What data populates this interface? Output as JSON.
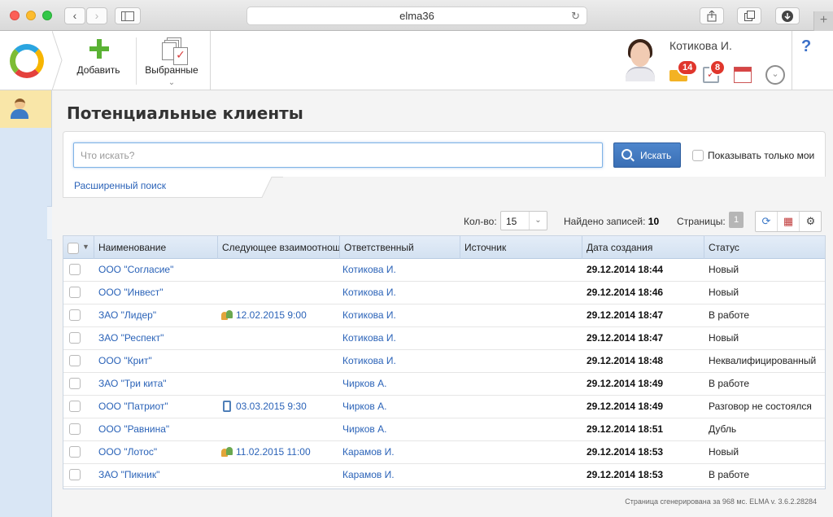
{
  "browser": {
    "url": "elma36",
    "back": "‹",
    "forward": "›",
    "new_tab": "+"
  },
  "toolbar": {
    "add_label": "Добавить",
    "favorites_label": "Выбранные"
  },
  "user": {
    "name": "Котикова И.",
    "mail_count": "14",
    "task_count": "8"
  },
  "help_label": "?",
  "page": {
    "title": "Потенциальные клиенты"
  },
  "search": {
    "placeholder": "Что искать?",
    "value": "",
    "button_label": "Искать",
    "only_mine_label": "Показывать только мои",
    "advanced_link": "Расширенный поиск"
  },
  "list_controls": {
    "qty_label": "Кол-во:",
    "qty_value": "15",
    "found_label": "Найдено записей:",
    "found_value": "10",
    "pages_label": "Страницы:",
    "current_page": "1"
  },
  "table": {
    "columns": [
      "Наименование",
      "Следующее взаимоотношение",
      "Ответственный",
      "Источник",
      "Дата создания",
      "Статус"
    ],
    "rows": [
      {
        "name": "ООО \"Согласие\"",
        "next": "",
        "next_icon": "",
        "owner": "Котикова И.",
        "source": "",
        "created": "29.12.2014 18:44",
        "status": "Новый"
      },
      {
        "name": "ООО \"Инвест\"",
        "next": "",
        "next_icon": "",
        "owner": "Котикова И.",
        "source": "",
        "created": "29.12.2014 18:46",
        "status": "Новый"
      },
      {
        "name": "ЗАО \"Лидер\"",
        "next": "12.02.2015 9:00",
        "next_icon": "meeting",
        "owner": "Котикова И.",
        "source": "",
        "created": "29.12.2014 18:47",
        "status": "В работе"
      },
      {
        "name": "ЗАО \"Респект\"",
        "next": "",
        "next_icon": "",
        "owner": "Котикова И.",
        "source": "",
        "created": "29.12.2014 18:47",
        "status": "Новый"
      },
      {
        "name": "ООО \"Крит\"",
        "next": "",
        "next_icon": "",
        "owner": "Котикова И.",
        "source": "",
        "created": "29.12.2014 18:48",
        "status": "Неквалифицированный"
      },
      {
        "name": "ЗАО \"Три кита\"",
        "next": "",
        "next_icon": "",
        "owner": "Чирков А.",
        "source": "",
        "created": "29.12.2014 18:49",
        "status": "В работе"
      },
      {
        "name": "ООО \"Патриот\"",
        "next": "03.03.2015 9:30",
        "next_icon": "phone",
        "owner": "Чирков А.",
        "source": "",
        "created": "29.12.2014 18:49",
        "status": "Разговор не состоялся"
      },
      {
        "name": "ООО \"Равнина\"",
        "next": "",
        "next_icon": "",
        "owner": "Чирков А.",
        "source": "",
        "created": "29.12.2014 18:51",
        "status": "Дубль"
      },
      {
        "name": "ООО \"Лотос\"",
        "next": "11.02.2015 11:00",
        "next_icon": "meeting",
        "owner": "Карамов И.",
        "source": "",
        "created": "29.12.2014 18:53",
        "status": "Новый"
      },
      {
        "name": "ЗАО \"Пикник\"",
        "next": "",
        "next_icon": "",
        "owner": "Карамов И.",
        "source": "",
        "created": "29.12.2014 18:53",
        "status": "В работе"
      }
    ]
  },
  "footer": "Страница сгенерирована за 968 мс. ELMA v. 3.6.2.28284",
  "colors": {
    "link": "#2b63b8",
    "accent_blue": "#3a6fb5",
    "add_green": "#5ab234",
    "badge_red": "#e0362c",
    "rail_bg": "#d9e6f5"
  }
}
